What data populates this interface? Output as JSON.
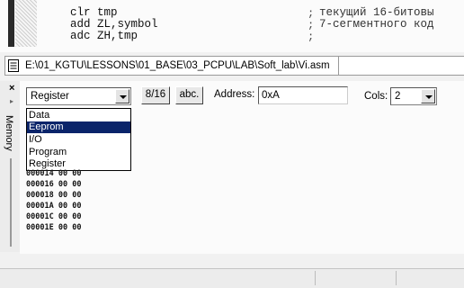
{
  "editor": {
    "code_lines": [
      "clr tmp",
      "add ZL,symbol",
      "adc ZH,tmp"
    ],
    "comment_lines": [
      "текущий 16-битовы",
      "7-сегментного код"
    ]
  },
  "file_tab": {
    "path": "E:\\01_KGTU\\LESSONS\\01_BASE\\03_PCPU\\LAB\\Soft_lab\\Vi.asm"
  },
  "memory_window": {
    "title": "Memory",
    "memory_type": {
      "selected": "Register",
      "options": [
        "Data",
        "Eeprom",
        "I/O",
        "Program",
        "Register"
      ],
      "highlighted": "Eeprom"
    },
    "toggle_8_16_label": "8/16",
    "ascii_label": "abc.",
    "address_label": "Address:",
    "address_value": "0xA",
    "cols_label": "Cols:",
    "cols_value": "2",
    "rows": [
      {
        "addr": "000014",
        "v1": "00",
        "v2": "00"
      },
      {
        "addr": "000016",
        "v1": "00",
        "v2": "00"
      },
      {
        "addr": "000018",
        "v1": "00",
        "v2": "00"
      },
      {
        "addr": "00001A",
        "v1": "00",
        "v2": "00"
      },
      {
        "addr": "00001C",
        "v1": "00",
        "v2": "00"
      },
      {
        "addr": "00001E",
        "v1": "00",
        "v2": "00"
      }
    ]
  }
}
